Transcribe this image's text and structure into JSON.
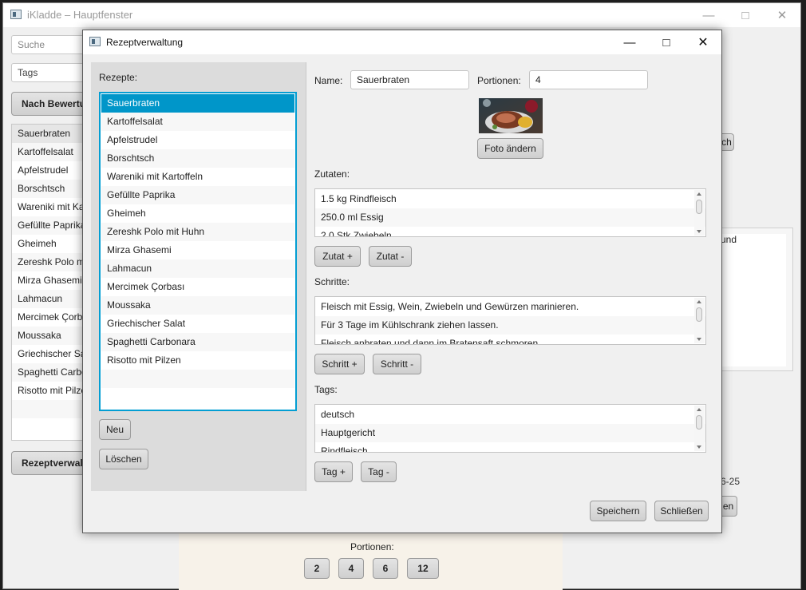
{
  "main_window": {
    "title": "iKladde – Hauptfenster",
    "search_placeholder": "Suche",
    "tags_placeholder": "Tags",
    "sort_button": "Nach Bewertu",
    "recipe_list": [
      "Sauerbraten",
      "Kartoffelsalat",
      "Apfelstrudel",
      "Borschtsch",
      "Wareniki mit Ka",
      "Gefüllte Paprika",
      "Gheimeh",
      "Zereshk Polo m",
      "Mirza Ghasemi",
      "Lahmacun",
      "Mercimek Çorb",
      "Moussaka",
      "Griechischer Sa",
      "Spaghetti Carbo",
      "Risotto mit Pilze"
    ],
    "manage_button": "Rezeptverwal",
    "right_button_fragment": "ch",
    "right_text_fragment": "und",
    "date_fragment": "6-25",
    "right_button2_fragment": "en",
    "portions_label": "Portionen:",
    "portion_buttons": [
      "2",
      "4",
      "6",
      "12"
    ]
  },
  "dialog": {
    "title": "Rezeptverwaltung",
    "recipes_label": "Rezepte:",
    "recipes": [
      "Sauerbraten",
      "Kartoffelsalat",
      "Apfelstrudel",
      "Borschtsch",
      "Wareniki mit Kartoffeln",
      "Gefüllte Paprika",
      "Gheimeh",
      "Zereshk Polo mit Huhn",
      "Mirza Ghasemi",
      "Lahmacun",
      "Mercimek Çorbası",
      "Moussaka",
      "Griechischer Salat",
      "Spaghetti Carbonara",
      "Risotto mit Pilzen"
    ],
    "selected_recipe": "Sauerbraten",
    "new_button": "Neu",
    "delete_button": "Löschen",
    "name_label": "Name:",
    "name_value": "Sauerbraten",
    "portions_label": "Portionen:",
    "portions_value": "4",
    "photo_button": "Foto ändern",
    "ingredients_label": "Zutaten:",
    "ingredients": [
      "1.5 kg Rindfleisch",
      "250.0 ml Essig",
      "2.0 Stk Zwiebeln"
    ],
    "ingredient_add": "Zutat +",
    "ingredient_remove": "Zutat -",
    "steps_label": "Schritte:",
    "steps": [
      "Fleisch mit Essig, Wein, Zwiebeln und Gewürzen marinieren.",
      "Für 3 Tage im Kühlschrank ziehen lassen.",
      "Fleisch anbraten und dann im Bratensaft schmoren."
    ],
    "step_add": "Schritt +",
    "step_remove": "Schritt -",
    "tags_label": "Tags:",
    "tags": [
      "deutsch",
      "Hauptgericht",
      "Rindfleisch"
    ],
    "tag_add": "Tag +",
    "tag_remove": "Tag -",
    "save_button": "Speichern",
    "close_button": "Schließen"
  },
  "colors": {
    "selection": "#0096c9",
    "list_focus_border": "#039ed3"
  }
}
